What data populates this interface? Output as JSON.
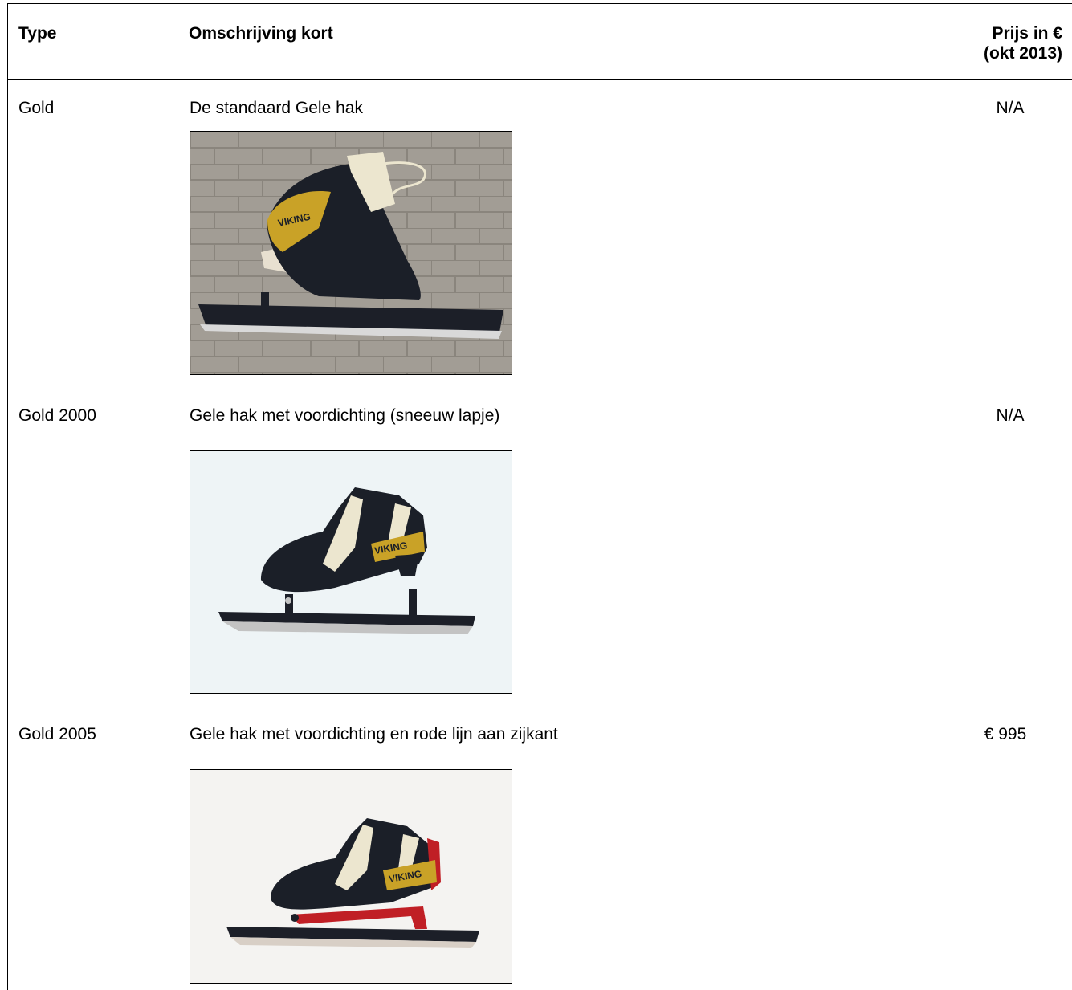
{
  "header": {
    "type": "Type",
    "description": "Omschrijving kort",
    "price_line1": "Prijs in €",
    "price_line2": "(okt 2013)"
  },
  "rows": [
    {
      "type": "Gold",
      "description": "De standaard Gele hak",
      "price": "N/A",
      "image": "skate-photo-viking-gold",
      "bg": "#9c9790"
    },
    {
      "type": "Gold 2000",
      "description": "Gele hak met voordichting (sneeuw lapje)",
      "price": "N/A",
      "image": "skate-photo-viking-gold-2000",
      "bg": "#eef4f6"
    },
    {
      "type": "Gold 2005",
      "description": "Gele hak met voordichting en rode lijn aan zijkant",
      "price": "€ 995",
      "image": "skate-photo-viking-gold-2005",
      "bg": "#f4f3f1"
    }
  ],
  "colors": {
    "gold": "#c9a227",
    "black": "#1b1f28",
    "cream": "#ece6cf",
    "red": "#c01f25",
    "blade": "#b8b8b8"
  }
}
